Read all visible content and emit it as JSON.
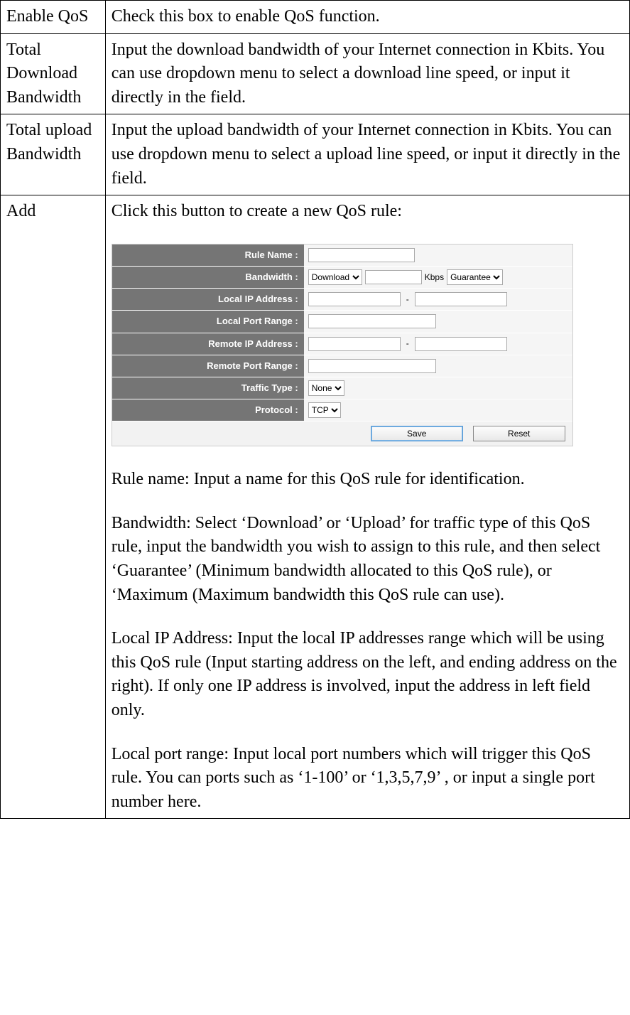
{
  "rows": {
    "r0": {
      "label": "Enable QoS",
      "desc": "Check this box to enable QoS function."
    },
    "r1": {
      "label": "Total Download Bandwidth",
      "desc": "Input the download bandwidth of your Internet connection in Kbits. You can use dropdown menu to select a download line speed, or input it directly in the field."
    },
    "r2": {
      "label": "Total upload Bandwidth",
      "desc": "Input the upload bandwidth of your Internet connection in Kbits. You can use dropdown menu to select a upload line speed, or input it directly in the field."
    },
    "r3": {
      "label": "Add",
      "intro": "Click this button to create a new QoS rule:"
    }
  },
  "form": {
    "rule_name_label": "Rule Name :",
    "bandwidth_label": "Bandwidth :",
    "bandwidth_direction": "Download",
    "bandwidth_unit": "Kbps",
    "bandwidth_mode": "Guarantee",
    "local_ip_label": "Local IP Address :",
    "local_port_label": "Local Port Range :",
    "remote_ip_label": "Remote IP Address :",
    "remote_port_label": "Remote Port Range :",
    "traffic_type_label": "Traffic Type :",
    "traffic_type_value": "None",
    "protocol_label": "Protocol :",
    "protocol_value": "TCP",
    "save_btn": "Save",
    "reset_btn": "Reset",
    "dash": "-"
  },
  "explain": {
    "rule_name": "Rule name: Input a name for this QoS rule for identification.",
    "bandwidth": "Bandwidth: Select ‘Download’ or ‘Upload’ for traffic type of this QoS rule, input the bandwidth you wish to assign to this rule, and then select ‘Guarantee’ (Minimum bandwidth allocated to this QoS rule), or ‘Maximum (Maximum bandwidth this QoS rule can use).",
    "local_ip": "Local IP Address: Input the local IP addresses range which will be using this QoS rule (Input starting address on the left, and ending address on the right). If only one IP address is involved, input the address in left field only.",
    "local_port": "Local port range: Input local port numbers which will trigger this QoS rule. You can ports such as ‘1-100’ or ‘1,3,5,7,9’ , or input a single port number here."
  }
}
